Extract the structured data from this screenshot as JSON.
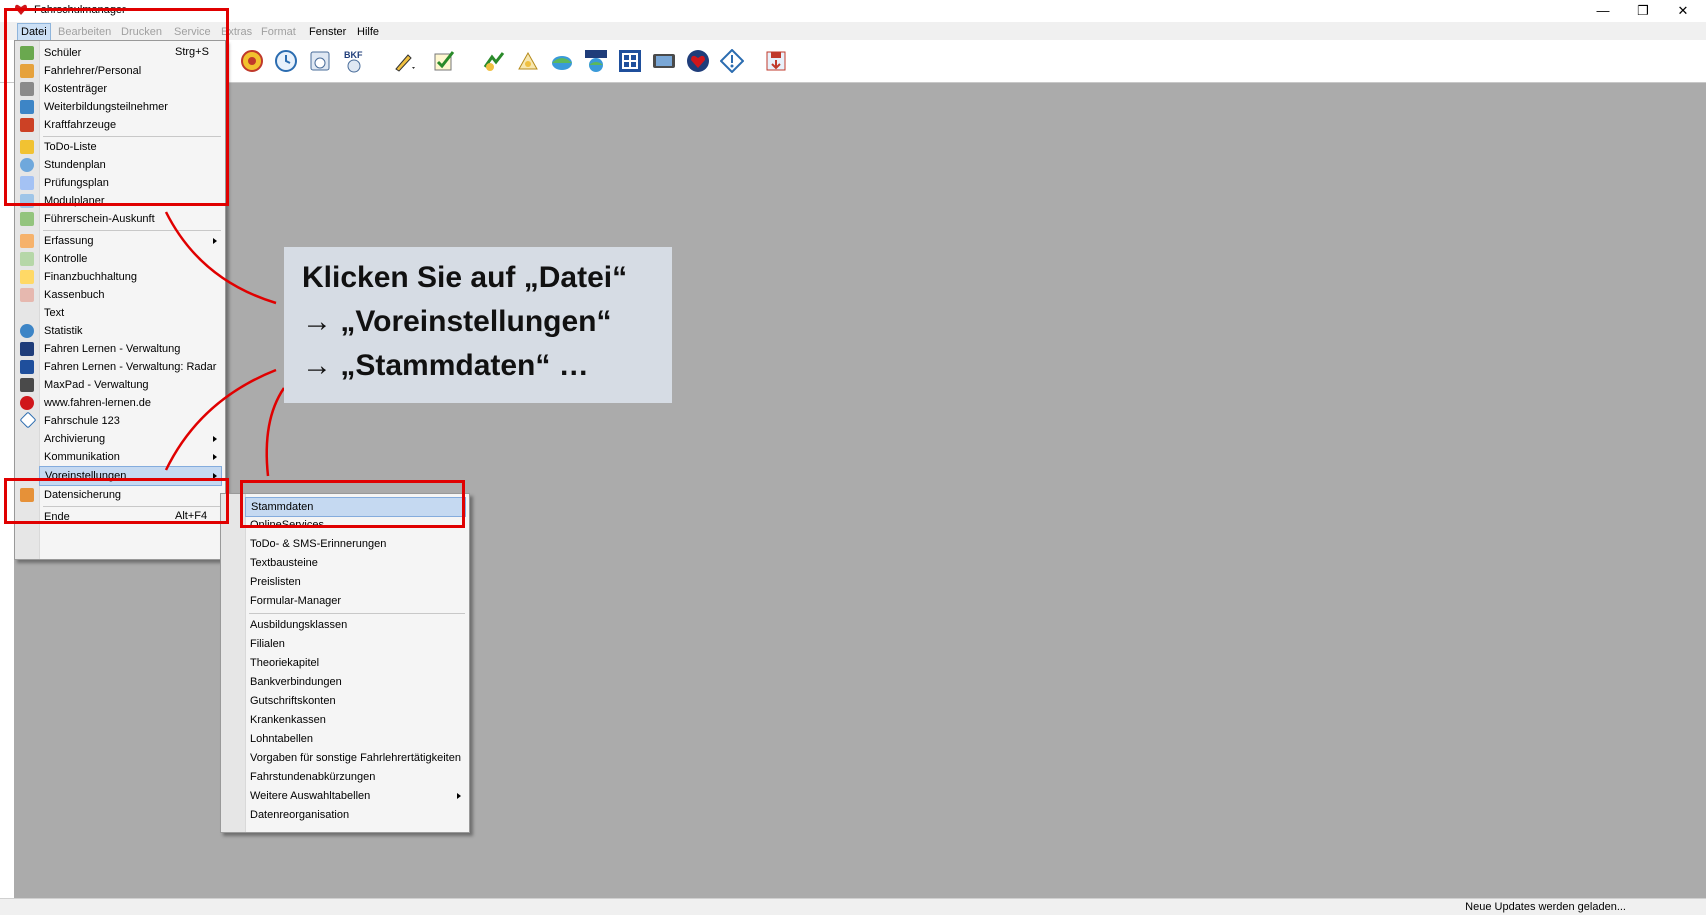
{
  "window": {
    "title": "Fahrschulmanager",
    "minimize": "—",
    "restore": "❐",
    "close": "✕"
  },
  "menubar": {
    "items": [
      {
        "label": "Datei",
        "state": "active"
      },
      {
        "label": "Bearbeiten",
        "state": "disabled"
      },
      {
        "label": "Drucken",
        "state": "disabled"
      },
      {
        "label": "Service",
        "state": "disabled"
      },
      {
        "label": "Extras",
        "state": "disabled"
      },
      {
        "label": "Format",
        "state": "disabled"
      },
      {
        "label": "Fenster",
        "state": "enabled"
      },
      {
        "label": "Hilfe",
        "state": "enabled"
      }
    ]
  },
  "datei_menu": {
    "items": [
      {
        "label": "Schüler",
        "shortcut": "Strg+S",
        "icon": "student-icon"
      },
      {
        "label": "Fahrlehrer/Personal",
        "icon": "instructor-icon"
      },
      {
        "label": "Kostenträger",
        "icon": "payer-icon"
      },
      {
        "label": "Weiterbildungsteilnehmer",
        "icon": "participants-icon"
      },
      {
        "label": "Kraftfahrzeuge",
        "icon": "vehicle-icon"
      },
      {
        "label": "ToDo-Liste",
        "icon": "todo-icon"
      },
      {
        "label": "Stundenplan",
        "icon": "clock-icon"
      },
      {
        "label": "Prüfungsplan",
        "icon": "exam-icon"
      },
      {
        "label": "Modulplaner",
        "icon": "module-icon"
      },
      {
        "label": "Führerschein-Auskunft",
        "icon": "license-icon"
      },
      {
        "label": "Erfassung",
        "icon": "pen-icon",
        "submenu": true
      },
      {
        "label": "Kontrolle",
        "icon": "check-icon"
      },
      {
        "label": "Finanzbuchhaltung",
        "icon": "finance-icon"
      },
      {
        "label": "Kassenbuch",
        "icon": "cashbook-icon"
      },
      {
        "label": "Text",
        "icon": "text-icon"
      },
      {
        "label": "Statistik",
        "icon": "statistics-icon"
      },
      {
        "label": "Fahren Lernen - Verwaltung",
        "icon": "fahren-lernen-icon"
      },
      {
        "label": "Fahren Lernen - Verwaltung: Radar",
        "icon": "radar-icon"
      },
      {
        "label": "MaxPad - Verwaltung",
        "icon": "tablet-icon"
      },
      {
        "label": "www.fahren-lernen.de",
        "icon": "heart-globe-icon"
      },
      {
        "label": "Fahrschule 123",
        "icon": "diamond-icon"
      },
      {
        "label": "Archivierung",
        "icon": "archive-icon",
        "submenu": true
      },
      {
        "label": "Kommunikation",
        "icon": "communication-icon",
        "submenu": true
      },
      {
        "label": "Voreinstellungen",
        "icon": "settings-icon",
        "submenu": true,
        "highlighted": true
      },
      {
        "label": "Datensicherung",
        "icon": "backup-icon"
      },
      {
        "label": "Ende",
        "shortcut": "Alt+F4",
        "icon": "exit-icon"
      }
    ]
  },
  "voreinstellungen_menu": {
    "items": [
      {
        "label": "Stammdaten",
        "highlighted": true
      },
      {
        "label": "OnlineServices"
      },
      {
        "label": "ToDo- & SMS-Erinnerungen"
      },
      {
        "label": "Textbausteine"
      },
      {
        "label": "Preislisten"
      },
      {
        "label": "Formular-Manager"
      },
      {
        "label": "Ausbildungsklassen"
      },
      {
        "label": "Filialen"
      },
      {
        "label": "Theoriekapitel"
      },
      {
        "label": "Bankverbindungen"
      },
      {
        "label": "Gutschriftskonten"
      },
      {
        "label": "Krankenkassen"
      },
      {
        "label": "Lohntabellen"
      },
      {
        "label": "Vorgaben für sonstige Fahrlehrertätigkeiten"
      },
      {
        "label": "Fahrstundenabkürzungen"
      },
      {
        "label": "Weitere Auswahltabellen",
        "submenu": true
      },
      {
        "label": "Datenreorganisation"
      }
    ]
  },
  "callout": {
    "line1": "Klicken Sie auf „Datei“",
    "line2": "→ „Voreinstellungen“",
    "line3": "→ „Stammdaten“ …"
  },
  "toolbar": {
    "icons": [
      "todo-icon",
      "clock-icon",
      "exam-icon",
      "bkf-icon",
      "pen-icon",
      "check-icon",
      "finance-icon",
      "cashbook-icon",
      "statistics-icon",
      "fahren-lernen-icon",
      "radar-icon",
      "tablet-icon",
      "heart-globe-icon",
      "diamond-icon",
      "save-icon"
    ],
    "bkf_label": "BKF"
  },
  "status": {
    "text": "Neue Updates werden geladen..."
  },
  "colors": {
    "highlight_box": "#e00000",
    "workspace": "#ababab",
    "callout_bg": "#d6dce4",
    "menu_highlight": "#c5d9f1"
  }
}
